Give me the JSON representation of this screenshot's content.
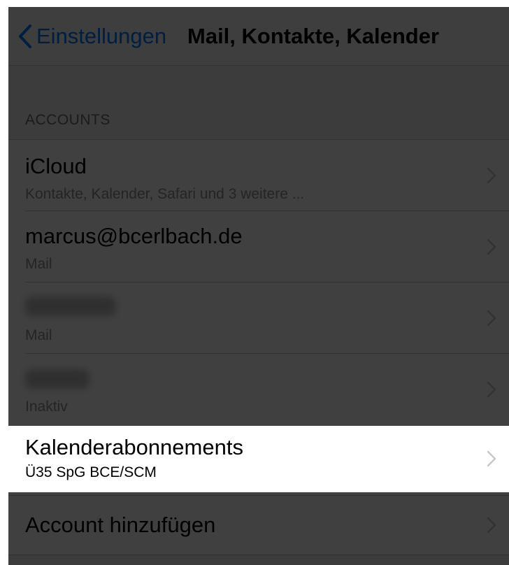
{
  "navbar": {
    "back_label": "Einstellungen",
    "title": "Mail, Kontakte, Kalender"
  },
  "section": {
    "header": "ACCOUNTS"
  },
  "rows": [
    {
      "title": "iCloud",
      "subtitle": "Kontakte, Kalender, Safari und 3 weitere ..."
    },
    {
      "title": "marcus@bcerlbach.de",
      "subtitle": "Mail"
    },
    {
      "title": "",
      "subtitle": "Mail"
    },
    {
      "title": "",
      "subtitle": "Inaktiv"
    },
    {
      "title": "Kalenderabonnements",
      "subtitle": "Ü35 SpG BCE/SCM"
    }
  ],
  "add_account": {
    "label": "Account hinzufügen"
  },
  "colors": {
    "accent": "#007aff",
    "overlay": "rgba(0,0,0,0.75)"
  },
  "icons": {
    "back": "chevron-left-icon",
    "disclosure": "chevron-right-icon"
  }
}
